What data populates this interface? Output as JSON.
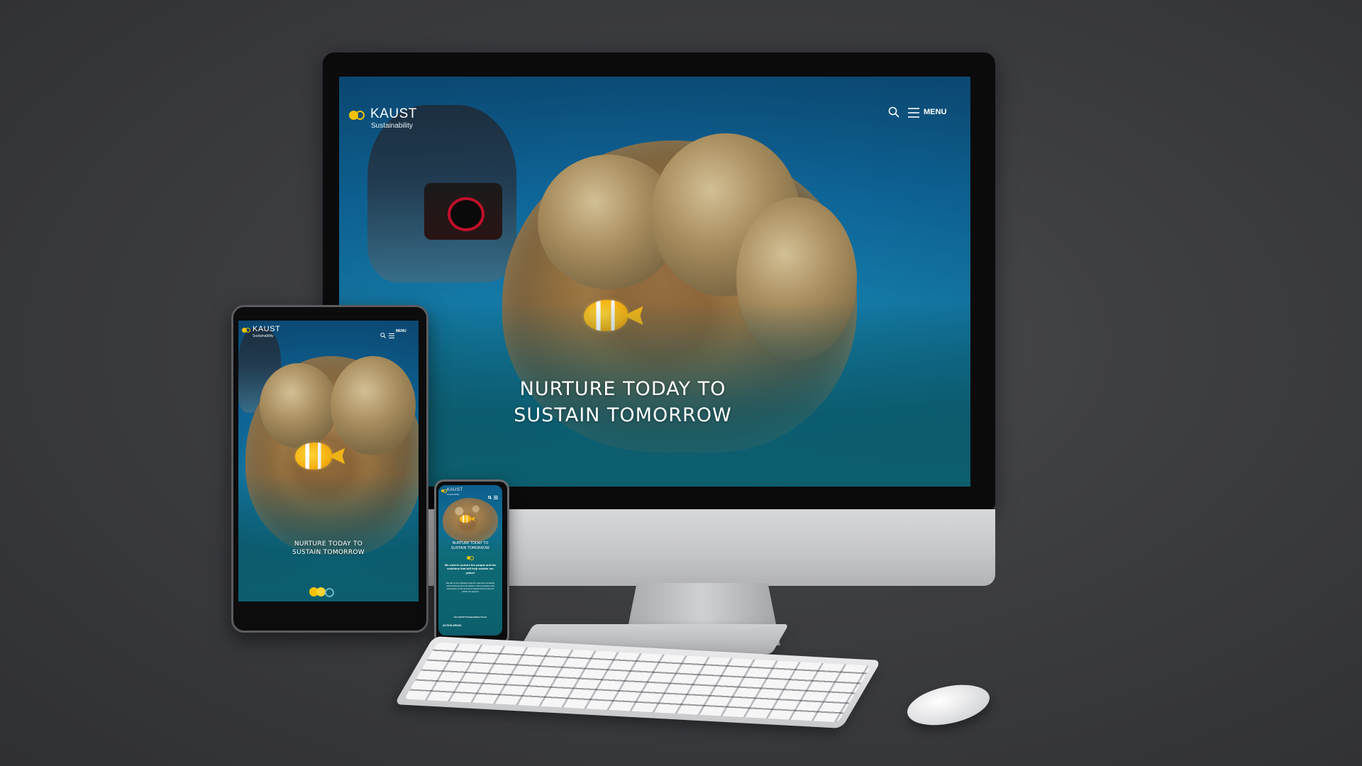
{
  "site": {
    "brand_name": "KAUST",
    "brand_sub": "Sustainability",
    "menu_label": "MENU",
    "hero_line1": "NURTURE TODAY TO",
    "hero_line2": "SUSTAIN TOMORROW"
  },
  "phone": {
    "intro": "We exist to nurture the people and the solutions that will help sustain our planet",
    "body": "We aim to be a global model for resource circularity and a technoeconomic leader in the protection and restoration of the land and coastal environment on which we depend",
    "link": "Our KAUST Sustainability Vision",
    "section": "ACTION AREAS"
  },
  "icons": {
    "search": "search-icon",
    "menu": "hamburger-menu-icon",
    "logo": "kaust-logo-icon",
    "pager": "pager-dots-icon"
  },
  "colors": {
    "background": "#3c3d41",
    "logo_yellow": "#f2c200",
    "sea_blue": "#0e679a"
  }
}
